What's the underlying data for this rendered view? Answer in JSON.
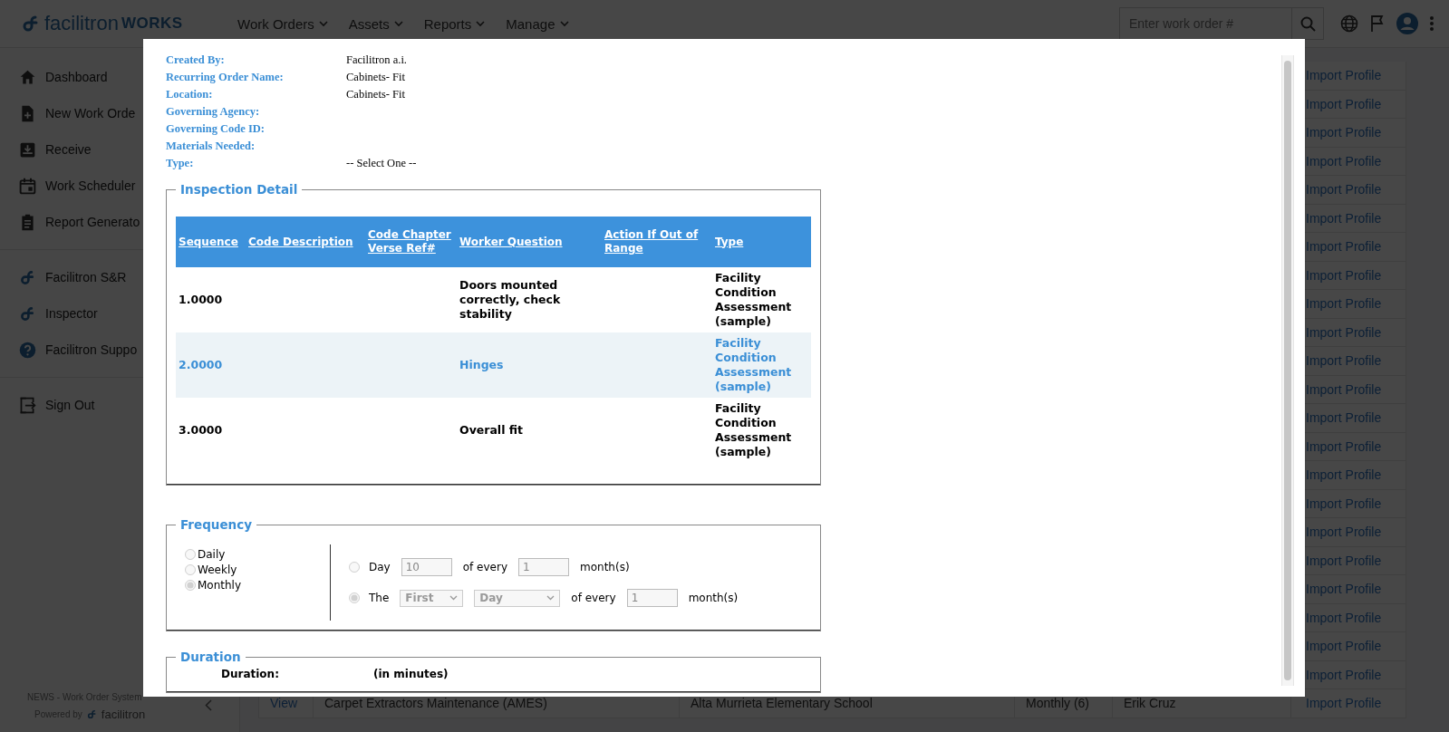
{
  "topbar": {
    "brand": "facilitron",
    "product": "WORKS",
    "nav": [
      {
        "label": "Work Orders"
      },
      {
        "label": "Assets"
      },
      {
        "label": "Reports"
      },
      {
        "label": "Manage"
      }
    ],
    "search": {
      "placeholder": "Enter work order #"
    }
  },
  "sidebar": {
    "groups": [
      [
        {
          "label": "Dashboard"
        },
        {
          "label": "New Work Orde"
        },
        {
          "label": "Receive"
        },
        {
          "label": "Work Scheduler"
        },
        {
          "label": "Report Generato"
        }
      ],
      [
        {
          "label": "Facilitron S&R"
        },
        {
          "label": "Inspector"
        },
        {
          "label": "Facilitron Suppo"
        }
      ],
      [
        {
          "label": "Sign Out"
        }
      ]
    ],
    "footer": {
      "system": "NEWS - Work Order System",
      "powered_by": "Powered by",
      "brand": "facilitron"
    }
  },
  "list": {
    "rows": [
      {
        "action": "Import Profile"
      },
      {
        "action": "Import Profile"
      },
      {
        "action": "Import Profile"
      },
      {
        "action": "Import Profile"
      },
      {
        "action": "Import Profile"
      },
      {
        "action": "Import Profile"
      },
      {
        "action": "Import Profile"
      },
      {
        "action": "Import Profile"
      },
      {
        "action": "Import Profile"
      },
      {
        "action": "Import Profile"
      },
      {
        "action": "Import Profile"
      },
      {
        "action": "Import Profile"
      },
      {
        "action": "Import Profile"
      },
      {
        "action": "Import Profile"
      },
      {
        "action": "Import Profile"
      },
      {
        "action": "Import Profile"
      },
      {
        "action": "Import Profile"
      },
      {
        "action": "Import Profile"
      },
      {
        "action": "Import Profile"
      },
      {
        "action": "Import Profile"
      },
      {
        "action": "Import Profile"
      },
      {
        "action": "Import Profile"
      },
      {
        "view": "View",
        "name": "Carpet Extractors Maintenance (AMES)",
        "location": "Alta Murrieta Elementary School",
        "frequency": "Monthly (6)",
        "assignee": "Erik Cruz",
        "action": "Import Profile"
      }
    ]
  },
  "modal": {
    "details": [
      {
        "label": "Created By:",
        "value": "Facilitron a.i."
      },
      {
        "label": "Recurring Order Name:",
        "value": "Cabinets- Fit"
      },
      {
        "label": "Location:",
        "value": "Cabinets- Fit"
      },
      {
        "label": "Governing Agency:"
      },
      {
        "label": "Governing Code ID:"
      },
      {
        "label": "Materials Needed:"
      },
      {
        "label": "Type:",
        "value": "-- Select One --"
      }
    ],
    "inspection": {
      "legend": "Inspection Detail",
      "columns": [
        "Sequence",
        "Code Description",
        "Code Chapter Verse Ref#",
        "Worker Question",
        "Action If Out of Range",
        "Type"
      ],
      "rows": [
        {
          "sequence": "1.0000",
          "worker_question": "Doors mounted correctly, check stability",
          "type": "Facility Condition Assessment (sample)",
          "selected": false
        },
        {
          "sequence": "2.0000",
          "worker_question": "Hinges",
          "type": "Facility Condition Assessment (sample)",
          "selected": true
        },
        {
          "sequence": "3.0000",
          "worker_question": "Overall fit",
          "type": "Facility Condition Assessment (sample)",
          "selected": false
        }
      ]
    },
    "frequency": {
      "legend": "Frequency",
      "disabled": true,
      "periods": [
        {
          "label": "Daily",
          "checked": false
        },
        {
          "label": "Weekly",
          "checked": false
        },
        {
          "label": "Monthly",
          "checked": true
        }
      ],
      "options": [
        {
          "kind": "day",
          "label": "Day",
          "checked": false,
          "day": "10",
          "of_every": "of every",
          "interval": "1",
          "unit": "month(s)"
        },
        {
          "kind": "ordinal",
          "label": "The",
          "checked": true,
          "ordinal": "First",
          "weekday": "Day",
          "of_every": "of every",
          "interval": "1",
          "unit": "month(s)"
        }
      ]
    },
    "duration": {
      "legend": "Duration",
      "label": "Duration:",
      "unit": "(in minutes)"
    }
  }
}
